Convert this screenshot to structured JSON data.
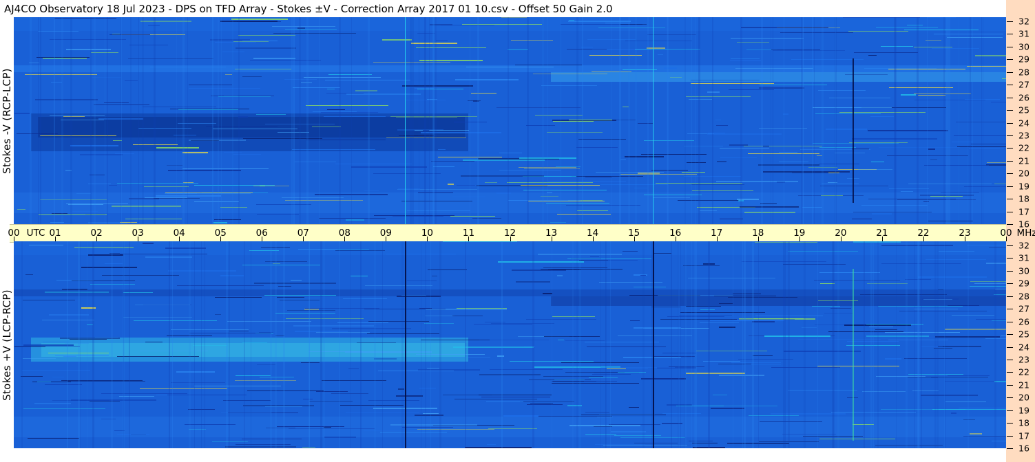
{
  "title": "AJ4CO Observatory  18 Jul 2023  -  DPS on TFD Array  -  Stokes ±V  -  Correction Array 2017 01 10.csv  -  Offset 50  Gain 2.0",
  "panels": {
    "top": {
      "ylabel": "Stokes -V (RCP-LCP)"
    },
    "bottom": {
      "ylabel": "Stokes +V (LCP-RCP)"
    }
  },
  "time_axis": {
    "labels": [
      "00",
      "01",
      "02",
      "03",
      "04",
      "05",
      "06",
      "07",
      "08",
      "09",
      "10",
      "11",
      "12",
      "13",
      "14",
      "15",
      "16",
      "17",
      "18",
      "19",
      "20",
      "21",
      "22",
      "23",
      "00"
    ],
    "utc_label": "UTC",
    "unit_label": "MHz"
  },
  "freq_axis": {
    "labels": [
      "32",
      "31",
      "30",
      "29",
      "28",
      "27",
      "26",
      "25",
      "24",
      "23",
      "22",
      "21",
      "20",
      "19",
      "18",
      "17",
      "16"
    ]
  },
  "colors": {
    "background": "#1a63d8",
    "axis_band": "#ffffc8",
    "right_strip": "#ffdcc0",
    "stripe_cyan": "#25d4ef",
    "stripe_dark": "#03104a"
  }
}
